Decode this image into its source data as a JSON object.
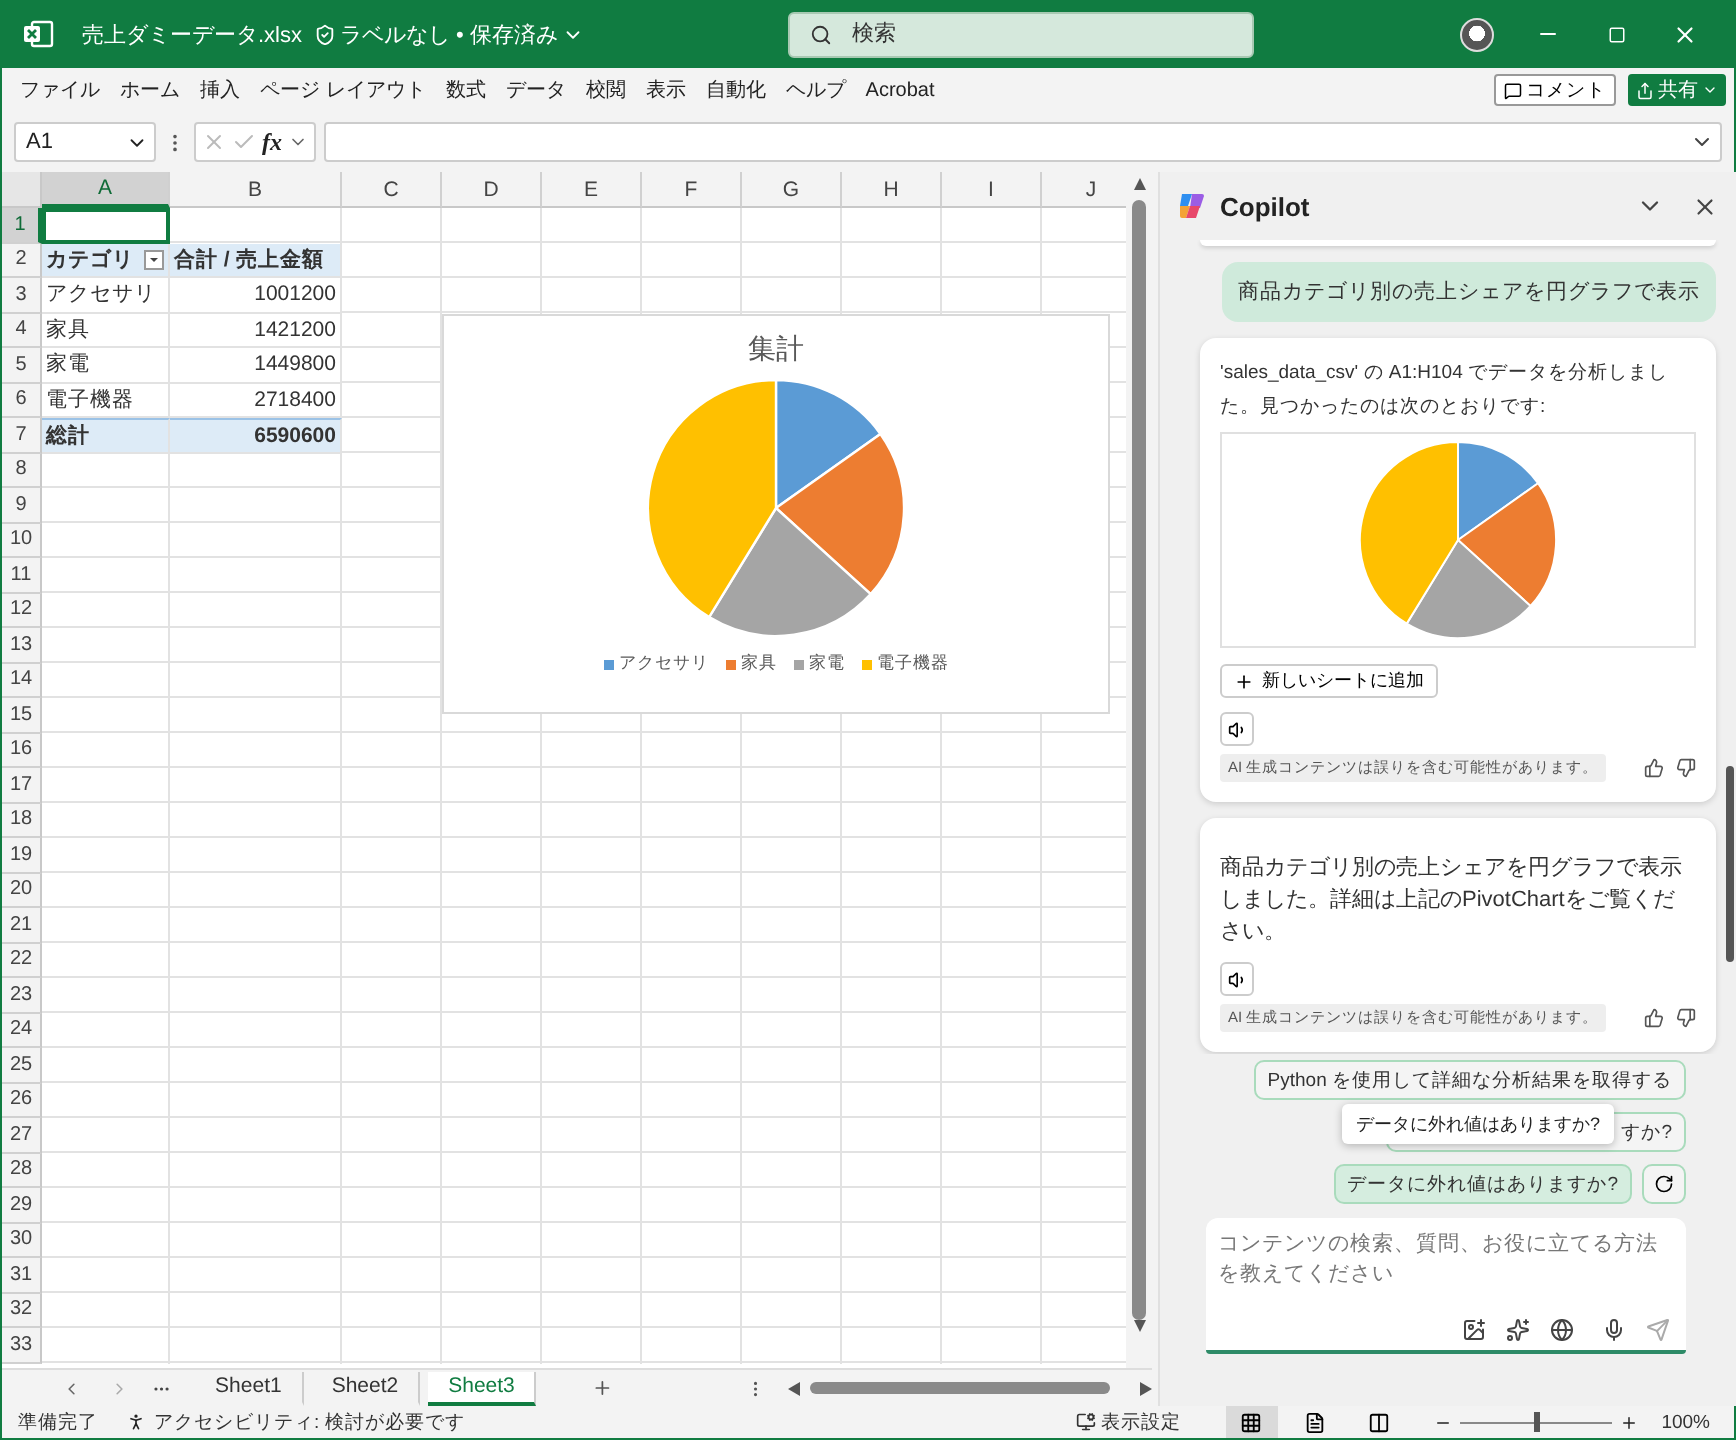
{
  "title_bar": {
    "file_name": "売上ダミーデータ.xlsx",
    "label_status": "ラベルなし • 保存済み",
    "search_placeholder": "検索"
  },
  "ribbon_tabs": [
    "ファイル",
    "ホーム",
    "挿入",
    "ページ レイアウト",
    "数式",
    "データ",
    "校閲",
    "表示",
    "自動化",
    "ヘルプ",
    "Acrobat"
  ],
  "ribbon_actions": {
    "comment": "コメント",
    "share": "共有"
  },
  "formula_bar": {
    "name_box": "A1",
    "function_label": "fx"
  },
  "sheet": {
    "columns": [
      {
        "label": "A",
        "selected": true
      },
      {
        "label": "B",
        "selected": false
      },
      {
        "label": "C",
        "selected": false
      },
      {
        "label": "D",
        "selected": false
      },
      {
        "label": "E",
        "selected": false
      },
      {
        "label": "F",
        "selected": false
      },
      {
        "label": "G",
        "selected": false
      },
      {
        "label": "H",
        "selected": false
      },
      {
        "label": "I",
        "selected": false
      },
      {
        "label": "J",
        "selected": false
      }
    ],
    "rows": [
      {
        "label": "1",
        "selected": true
      },
      {
        "label": "2",
        "selected": false
      },
      {
        "label": "3",
        "selected": false
      },
      {
        "label": "4",
        "selected": false
      },
      {
        "label": "5",
        "selected": false
      },
      {
        "label": "6",
        "selected": false
      },
      {
        "label": "7",
        "selected": false
      },
      {
        "label": "8",
        "selected": false
      },
      {
        "label": "9",
        "selected": false
      },
      {
        "label": "10",
        "selected": false
      },
      {
        "label": "11",
        "selected": false
      },
      {
        "label": "12",
        "selected": false
      },
      {
        "label": "13",
        "selected": false
      },
      {
        "label": "14",
        "selected": false
      },
      {
        "label": "15",
        "selected": false
      },
      {
        "label": "16",
        "selected": false
      },
      {
        "label": "17",
        "selected": false
      },
      {
        "label": "18",
        "selected": false
      },
      {
        "label": "19",
        "selected": false
      },
      {
        "label": "20",
        "selected": false
      },
      {
        "label": "21",
        "selected": false
      },
      {
        "label": "22",
        "selected": false
      },
      {
        "label": "23",
        "selected": false
      },
      {
        "label": "24",
        "selected": false
      },
      {
        "label": "25",
        "selected": false
      },
      {
        "label": "26",
        "selected": false
      },
      {
        "label": "27",
        "selected": false
      },
      {
        "label": "28",
        "selected": false
      },
      {
        "label": "29",
        "selected": false
      },
      {
        "label": "30",
        "selected": false
      },
      {
        "label": "31",
        "selected": false
      },
      {
        "label": "32",
        "selected": false
      },
      {
        "label": "33",
        "selected": false
      }
    ],
    "pivot": {
      "header": [
        "カテゴリ",
        "合計 / 売上金額"
      ],
      "rows": [
        [
          "アクセサリ",
          "1001200"
        ],
        [
          "家具",
          "1421200"
        ],
        [
          "家電",
          "1449800"
        ],
        [
          "電子機器",
          "2718400"
        ]
      ],
      "total": [
        "総計",
        "6590600"
      ]
    },
    "chart": {
      "chart_data": {
        "type": "pie",
        "title": "集計",
        "categories": [
          "アクセサリ",
          "家具",
          "家電",
          "電子機器"
        ],
        "series": [
          {
            "values": [
              15.19,
              21.56,
              22.0,
              41.25
            ]
          }
        ],
        "legend": "bottom"
      }
    }
  },
  "sheet_tabs": [
    {
      "label": "Sheet1",
      "selected": false
    },
    {
      "label": "Sheet2",
      "selected": false
    },
    {
      "label": "Sheet3",
      "selected": true
    }
  ],
  "copilot": {
    "title": "Copilot",
    "messages": [
      {
        "kind": "user",
        "text": "商品カテゴリ別の売上シェアを円グラフで表示"
      },
      {
        "kind": "assistant",
        "text": "'sales_data_csv' の A1:H104 でデータを分析しました。見つかったのは次のとおりです:",
        "has_chart": true,
        "action": "新しいシートに追加",
        "disclaimer": "AI 生成コンテンツは誤りを含む可能性があります。"
      },
      {
        "kind": "assistant",
        "text": "商品カテゴリ別の売上シェアを円グラフで表示しました。詳細は上記のPivotChartをご覧ください。",
        "disclaimer": "AI 生成コンテンツは誤りを含む可能性があります。"
      }
    ],
    "suggestions": [
      {
        "text": "Python を使用して詳細な分析結果を取得する",
        "hovered": false
      },
      {
        "text": "すか?",
        "hovered": false
      },
      {
        "text": "データに外れ値はありますか?",
        "hovered": true
      }
    ],
    "tooltip": "データに外れ値はありますか?",
    "input_placeholder": "コンテンツの検索、質問、お役に立てる方法を教えてください"
  },
  "status_bar": {
    "ready": "準備完了",
    "accessibility": "アクセシビリティ: 検討が必要です",
    "display_settings": "表示設定",
    "views": [
      {
        "kind": "normal",
        "selected": true
      },
      {
        "kind": "page_layout",
        "selected": false
      },
      {
        "kind": "page_break",
        "selected": false
      }
    ],
    "zoom": {
      "level": 0.5,
      "reading": "100%"
    }
  }
}
